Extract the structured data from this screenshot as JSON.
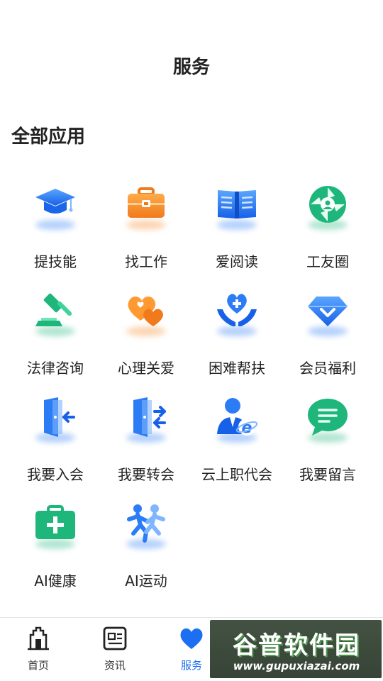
{
  "header": {
    "title": "服务"
  },
  "section": {
    "title": "全部应用"
  },
  "apps": [
    {
      "label": "提技能",
      "icon": "graduation-cap-icon"
    },
    {
      "label": "找工作",
      "icon": "briefcase-icon"
    },
    {
      "label": "爱阅读",
      "icon": "book-icon"
    },
    {
      "label": "工友圈",
      "icon": "camera-aperture-icon"
    },
    {
      "label": "法律咨询",
      "icon": "gavel-icon"
    },
    {
      "label": "心理关爱",
      "icon": "hearts-icon"
    },
    {
      "label": "困难帮扶",
      "icon": "helping-hands-icon"
    },
    {
      "label": "会员福利",
      "icon": "diamond-icon"
    },
    {
      "label": "我要入会",
      "icon": "door-enter-icon"
    },
    {
      "label": "我要转会",
      "icon": "door-transfer-icon"
    },
    {
      "label": "云上职代会",
      "icon": "person-ie-icon"
    },
    {
      "label": "我要留言",
      "icon": "chat-bubble-icon"
    },
    {
      "label": "AI健康",
      "icon": "medical-kit-icon"
    },
    {
      "label": "AI运动",
      "icon": "running-people-icon"
    }
  ],
  "tabbar": {
    "tabs": [
      {
        "label": "首页",
        "icon": "home-gate-icon",
        "active": false
      },
      {
        "label": "资讯",
        "icon": "news-icon",
        "active": false
      },
      {
        "label": "服务",
        "icon": "heart-icon",
        "active": true
      },
      {
        "label": "",
        "icon": "",
        "active": false
      },
      {
        "label": "",
        "icon": "",
        "active": false
      }
    ]
  },
  "watermark": {
    "text": "谷普软件园",
    "url": "www.gupuxiazai.com"
  },
  "colors": {
    "accent": "#1d6ff2",
    "green": "#1fb67c",
    "orange": "#f5892a"
  }
}
